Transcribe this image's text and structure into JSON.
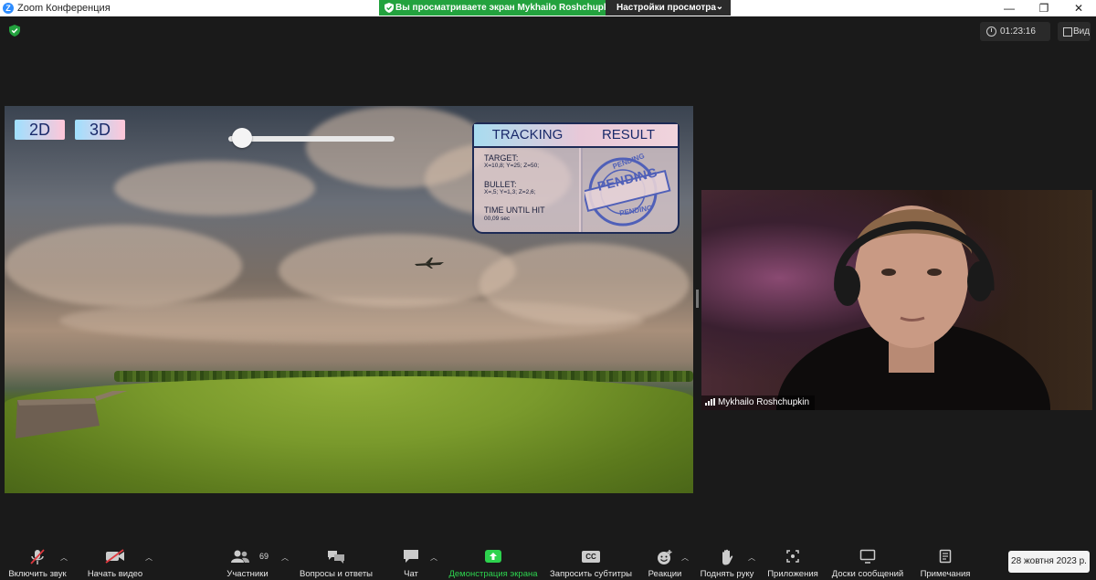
{
  "window": {
    "app_title": "Zoom Конференция",
    "app_icon_letter": "Z",
    "share_banner": "Вы просматриваете экран Mykhailo Roshchupkin",
    "view_settings": "Настройки просмотра",
    "controls": {
      "minimize": "—",
      "maximize": "❐",
      "close": "✕"
    }
  },
  "header": {
    "timer": "01:23:16",
    "view_label": "Вид"
  },
  "game": {
    "btn_2d": "2D",
    "btn_3d": "3D",
    "slider_fraction": 0.08,
    "tracking": {
      "title": "TRACKING",
      "target_label": "TARGET:",
      "target_value": "X=10,8; Y=25; Z=50;",
      "bullet_label": "BULLET:",
      "bullet_value": "X=,5; Y=1,3; Z=2,6;",
      "time_label": "TIME UNTIL HIT",
      "time_value": "00,09 sec"
    },
    "result": {
      "title": "RESULT",
      "stamp_word": "PENDING",
      "stamp_ring_top": "PENDING",
      "stamp_ring_bottom": "PENDING"
    }
  },
  "participant": {
    "name": "Mykhailo Roshchupkin"
  },
  "toolbar": {
    "unmute": "Включить звук",
    "start_video": "Начать видео",
    "participants": "Участники",
    "participants_count": "69",
    "qa": "Вопросы и ответы",
    "chat": "Чат",
    "share_screen": "Демонстрация экрана",
    "captions": "Запросить субтитры",
    "captions_badge": "CC",
    "reactions": "Реакции",
    "raise_hand": "Поднять руку",
    "apps": "Приложения",
    "whiteboards": "Доски сообщений",
    "notes": "Примечания"
  },
  "date_tooltip": "28 жовтня 2023 р.",
  "colors": {
    "share_green": "#23a23e",
    "share_label_green": "#2dd24e",
    "zoom_blue": "#2d8cff"
  }
}
